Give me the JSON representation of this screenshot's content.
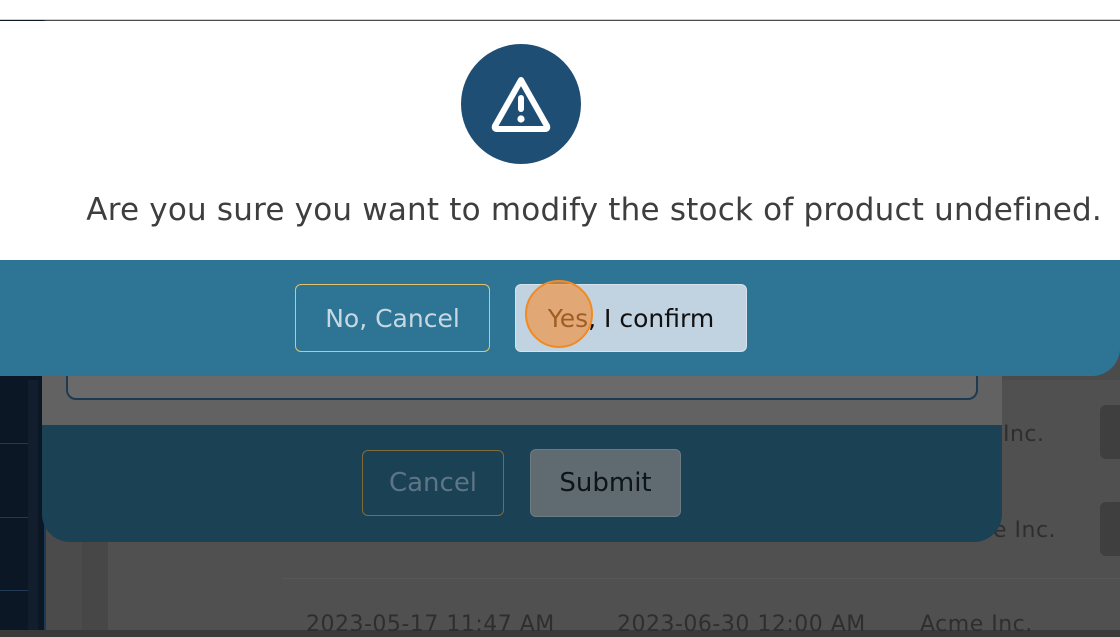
{
  "background_table": {
    "rows": [
      {
        "company": "Inc."
      },
      {
        "company": "e Inc."
      },
      {
        "created": "2023-05-17 11:47 AM",
        "expires": "2023-06-30 12:00 AM",
        "company": "Acme Inc."
      }
    ]
  },
  "stock_modal": {
    "cancel_label": "Cancel",
    "submit_label": "Submit"
  },
  "confirm_dialog": {
    "icon": "warning-triangle-icon",
    "message": "Are you sure you want to modify the stock of product undefined.",
    "no_label": "No, Cancel",
    "yes_label": "Yes, I confirm"
  },
  "colors": {
    "dialog_footer": "#2e7595",
    "icon_circle": "#1f4e75",
    "cancel_border": "#e3c36a",
    "confirm_button": "#c1d2e0",
    "click_indicator": "#f08a23"
  }
}
